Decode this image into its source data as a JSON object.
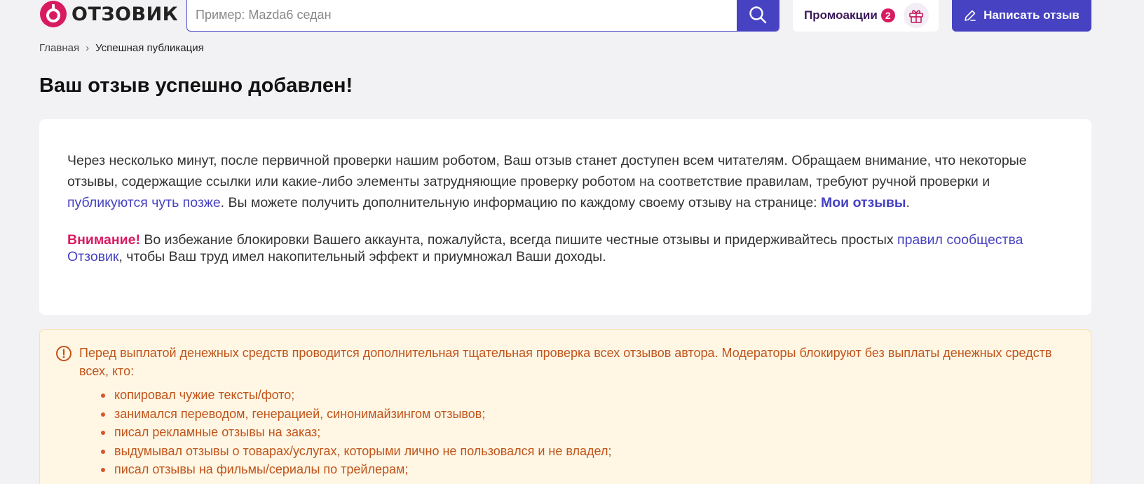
{
  "header": {
    "logo_text": "ОТЗОВИК",
    "search_placeholder": "Пример: Mazda6 седан",
    "promo_label": "Промоакции",
    "promo_count": "2",
    "write_review_label": "Написать отзыв"
  },
  "breadcrumb": {
    "home": "Главная",
    "separator": "›",
    "current": "Успешная публикация"
  },
  "page_title": "Ваш отзыв успешно добавлен!",
  "message": {
    "p1_start": "Через несколько минут, после первичной проверки нашим роботом, Ваш отзыв станет доступен всем читателям. Обращаем внимание, что некоторые отзывы, содержащие ссылки или какие-либо элементы затрудняющие проверку роботом на соответствие правилам, требуют ручной проверки и ",
    "p1_link": "публикуются чуть позже",
    "p1_mid": ". Вы можете получить дополнительную информацию по каждому своему отзыву на странице: ",
    "p1_link2": "Мои отзывы",
    "p1_end": ".",
    "attention_label": "Внимание!",
    "p2_start": " Во избежание блокировки Вашего аккаунта, пожалуйста, всегда пишите честные отзывы и придерживайтесь простых ",
    "p2_link": "правил сообщества Отзовик",
    "p2_end": ", чтобы Ваш труд имел накопительный эффект и приумножал Ваши доходы."
  },
  "notice": {
    "text": "Перед выплатой денежных средств проводится дополнительная тщательная проверка всех отзывов автора. Модераторы блокируют без выплаты денежных средств всех, кто:",
    "items": [
      "копировал чужие тексты/фото;",
      "занимался переводом, генерацией, синонимайзингом отзывов;",
      "писал рекламные отзывы на заказ;",
      "выдумывал отзывы о товарах/услугах, которыми лично не пользовался и не владел;",
      "писал отзывы на фильмы/сериалы по трейлерам;"
    ]
  },
  "colors": {
    "brand_purple": "#4642c2",
    "brand_pink": "#d81b60",
    "notice_text": "#c0541a",
    "notice_bg": "#fff6e4"
  }
}
